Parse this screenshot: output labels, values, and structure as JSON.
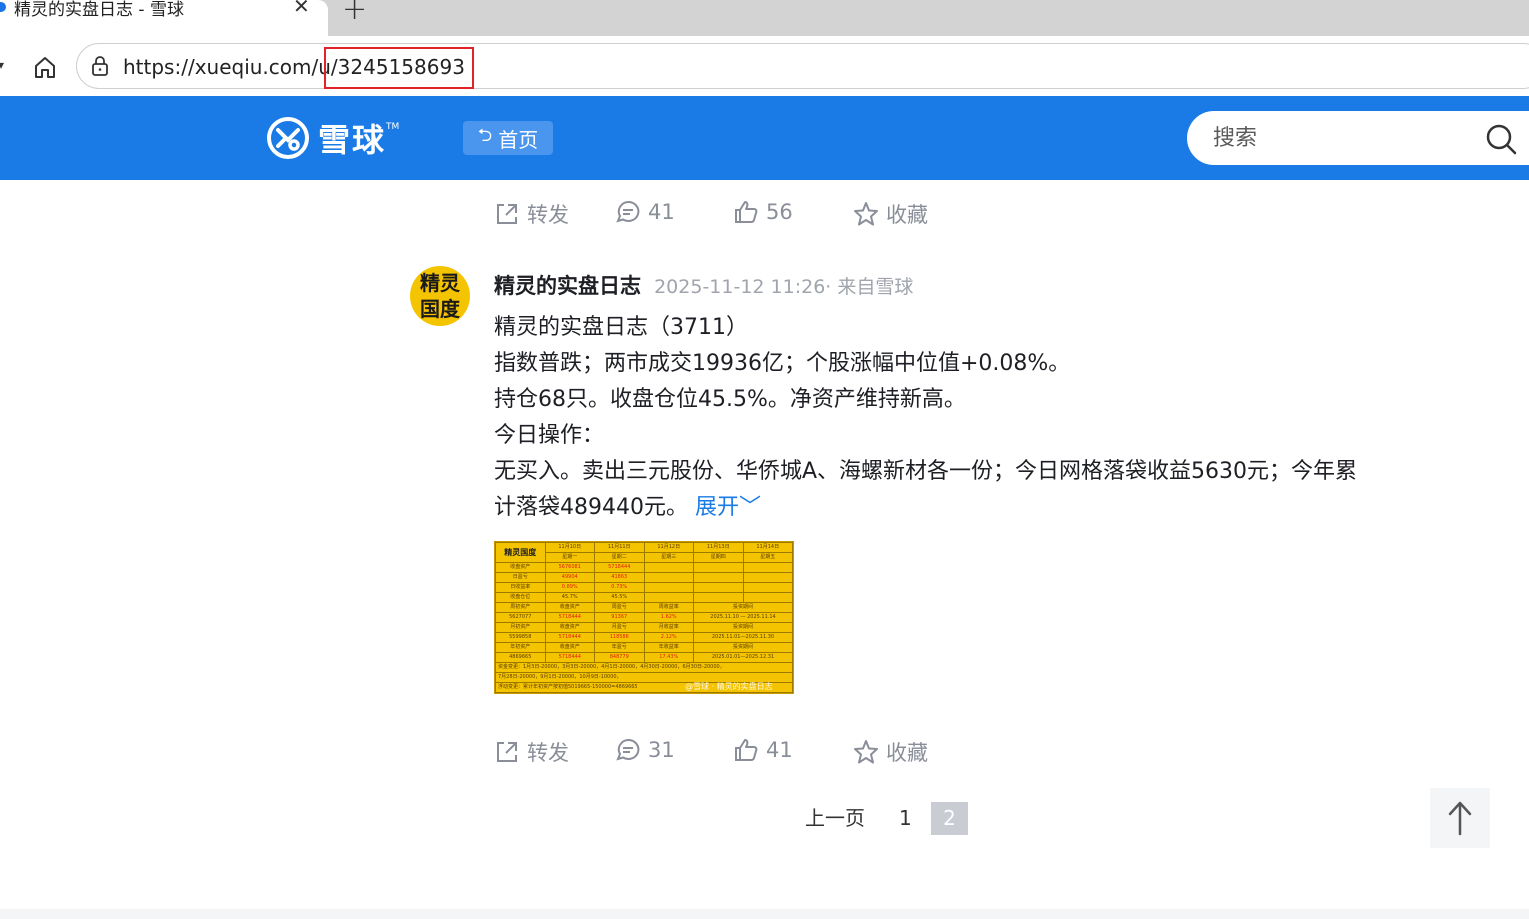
{
  "browser": {
    "tab_title": "精灵的实盘日志 - 雪球",
    "tab_close": "✕",
    "new_tab": "+",
    "url_base": "https://xueqiu.com/u/",
    "url_id": "3245158693"
  },
  "header": {
    "brand": "雪球",
    "home_label": "首页",
    "search_placeholder": "搜索",
    "colors": {
      "bar": "#1a7be6",
      "accent": "#1a7be6"
    }
  },
  "prev_post_actions": {
    "repost_label": "转发",
    "comments": "41",
    "likes": "56",
    "favorite_label": "收藏"
  },
  "post": {
    "avatar_line1": "精灵",
    "avatar_line2": "国度",
    "author": "精灵的实盘日志",
    "meta": "2025-11-12 11:26· 来自雪球",
    "lines": [
      "精灵的实盘日志（3711）",
      "指数普跌；两市成交19936亿；个股涨幅中位值+0.08%。",
      "持仓68只。收盘仓位45.5%。净资产维持新高。",
      "今日操作：",
      "无买入。卖出三元股份、华侨城A、海螺新材各一份；今日网格落袋收益5630元；今年累",
      "计落袋489440元。"
    ],
    "expand_label": "展开",
    "image": {
      "corner": "精灵国度",
      "headers": [
        "11月10日",
        "11月11日",
        "11月12日",
        "11月13日",
        "11月14日"
      ],
      "weekdays": [
        "星期一",
        "星期二",
        "星期三",
        "星期四",
        "星期五"
      ],
      "rows": [
        {
          "label": "收盘资产",
          "values": [
            "5676081",
            "5718444",
            "",
            "",
            ""
          ]
        },
        {
          "label": "日盈亏",
          "values": [
            "49904",
            "41863",
            "",
            "",
            ""
          ]
        },
        {
          "label": "日收益率",
          "values": [
            "0.89%",
            "0.73%",
            "",
            "",
            ""
          ]
        },
        {
          "label": "收盘仓位",
          "values": [
            "45.7%",
            "45.5%",
            "",
            "",
            ""
          ]
        }
      ],
      "period_rows": [
        [
          "周初资产",
          "收盘资产",
          "周盈亏",
          "周收益率",
          "投资期间"
        ],
        [
          "5627077",
          "5718444",
          "91367",
          "1.62%",
          "2025.11.10 — 2025.11.14"
        ],
        [
          "月初资产",
          "收盘资产",
          "月盈亏",
          "月收益率",
          "投资期间"
        ],
        [
          "5599858",
          "5718444",
          "118586",
          "2.12%",
          "2025.11.01—2025.11.30"
        ],
        [
          "年初资产",
          "收盘资产",
          "年盈亏",
          "年收益率",
          "投资期间"
        ],
        [
          "4869665",
          "5718444",
          "848779",
          "17.43%",
          "2025.01.01—2025.12.31"
        ]
      ],
      "note1": "资金变更：1月3日-20000，3月3日-20000，4月1日-20000，4月30日-20000，6月30日-20000，",
      "note2": "7月28日-20000，9月1日-20000，10月9日-10000，",
      "note3": "浮动变更：累计年初资产按初值5019665-150000=4869665",
      "watermark": "@雪球 · 精灵的实盘日志"
    },
    "actions": {
      "repost_label": "转发",
      "comments": "31",
      "likes": "41",
      "favorite_label": "收藏"
    }
  },
  "pagination": {
    "prev_label": "上一页",
    "pages": [
      "1",
      "2"
    ],
    "current": "2"
  }
}
